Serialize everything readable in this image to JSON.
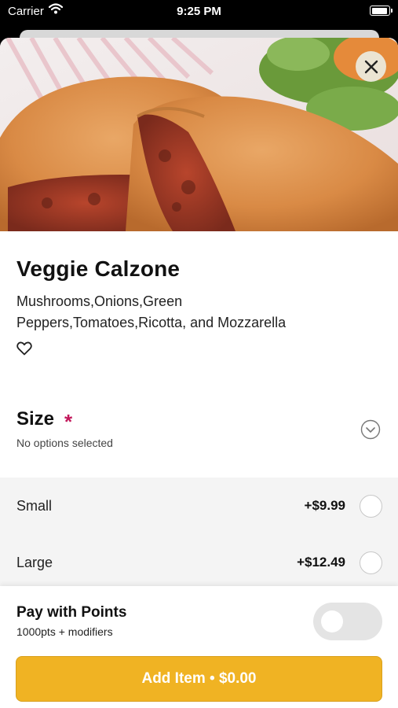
{
  "status_bar": {
    "carrier": "Carrier",
    "time": "9:25 PM"
  },
  "item": {
    "title": "Veggie Calzone",
    "description": "Mushrooms,Onions,Green Peppers,Tomatoes,Ricotta, and Mozzarella"
  },
  "size_section": {
    "title": "Size",
    "required_mark": "*",
    "subtitle": "No options selected",
    "options": [
      {
        "name": "Small",
        "price": "+$9.99",
        "selected": false
      },
      {
        "name": "Large",
        "price": "+$12.49",
        "selected": false
      }
    ]
  },
  "points": {
    "title": "Pay with Points",
    "subtitle": "1000pts + modifiers",
    "enabled": false
  },
  "add_button": {
    "label": "Add Item • $0.00"
  },
  "colors": {
    "accent": "#f0b323",
    "required": "#c2185b",
    "options_bg": "#f4f4f4",
    "toggle_off": "#e4e4e4"
  },
  "icons": {
    "close": "close-icon",
    "favorite": "heart-outline-icon",
    "expand": "chevron-down-circle-icon",
    "wifi": "wifi-icon",
    "battery": "battery-icon"
  }
}
